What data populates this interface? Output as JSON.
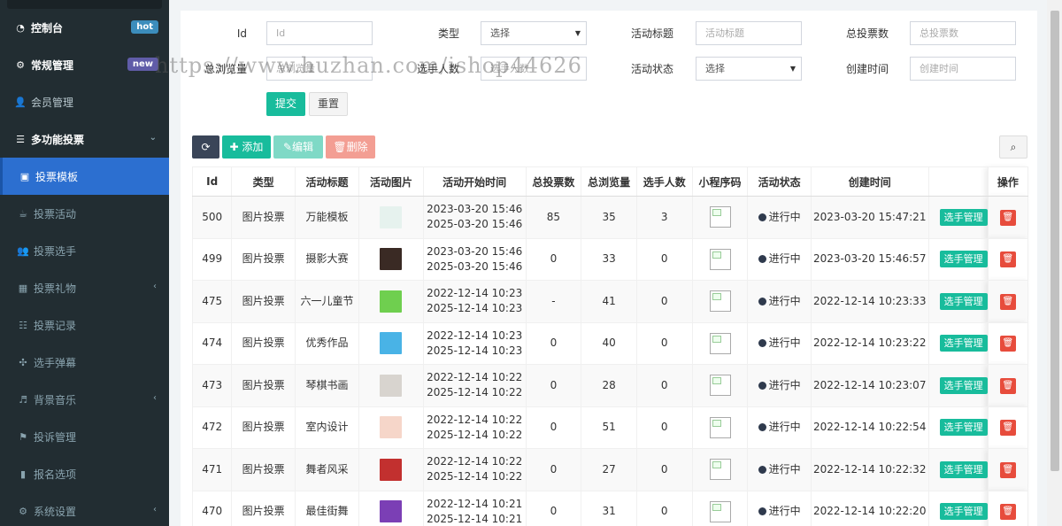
{
  "sidebar": {
    "items": [
      {
        "label": "控制台",
        "icon": "dashboard-icon",
        "badge": "hot"
      },
      {
        "label": "常规管理",
        "icon": "cogs-icon",
        "badge": "new"
      },
      {
        "label": "会员管理",
        "icon": "user-icon"
      },
      {
        "label": "多功能投票",
        "icon": "list-icon"
      },
      {
        "label": "投票模板",
        "icon": "template-icon"
      },
      {
        "label": "投票活动",
        "icon": "activity-icon"
      },
      {
        "label": "投票选手",
        "icon": "users-icon"
      },
      {
        "label": "投票礼物",
        "icon": "gift-icon"
      },
      {
        "label": "投票记录",
        "icon": "record-icon"
      },
      {
        "label": "选手弹幕",
        "icon": "barrage-icon"
      },
      {
        "label": "背景音乐",
        "icon": "music-icon"
      },
      {
        "label": "投诉管理",
        "icon": "flag-icon"
      },
      {
        "label": "报名选项",
        "icon": "signup-icon"
      },
      {
        "label": "系统设置",
        "icon": "settings-icon"
      }
    ]
  },
  "search_form": {
    "id_label": "Id",
    "id_placeholder": "Id",
    "type_label": "类型",
    "type_value": "选择",
    "title_label": "活动标题",
    "title_placeholder": "活动标题",
    "votes_label": "总投票数",
    "votes_placeholder": "总投票数",
    "views_label": "总浏览量",
    "views_placeholder": "总浏览量",
    "players_label": "选手人数",
    "players_placeholder": "选手人数",
    "status_label": "活动状态",
    "status_value": "选择",
    "created_label": "创建时间",
    "created_placeholder": "创建时间",
    "submit_label": "提交",
    "reset_label": "重置"
  },
  "toolbar": {
    "add_label": "添加",
    "edit_label": "编辑",
    "delete_label": "删除"
  },
  "table": {
    "columns": [
      "Id",
      "类型",
      "活动标题",
      "活动图片",
      "活动开始时间",
      "总投票数",
      "总浏览量",
      "选手人数",
      "小程序码",
      "活动状态",
      "创建时间",
      "",
      "操作"
    ],
    "manage_label": "选手管理",
    "rows": [
      {
        "id": "500",
        "type": "图片投票",
        "title": "万能模板",
        "start": "2023-03-20 15:46",
        "end": "2025-03-20 15:46",
        "votes": "85",
        "views": "35",
        "players": "3",
        "status": "进行中",
        "created": "2023-03-20 15:47:21",
        "thumb_color": "#e6f2ee"
      },
      {
        "id": "499",
        "type": "图片投票",
        "title": "摄影大赛",
        "start": "2023-03-20 15:46",
        "end": "2025-03-20 15:46",
        "votes": "0",
        "views": "33",
        "players": "0",
        "status": "进行中",
        "created": "2023-03-20 15:46:57",
        "thumb_color": "#3a2a24"
      },
      {
        "id": "475",
        "type": "图片投票",
        "title": "六一儿童节",
        "start": "2022-12-14 10:23",
        "end": "2025-12-14 10:23",
        "votes": "-",
        "views": "41",
        "players": "0",
        "status": "进行中",
        "created": "2022-12-14 10:23:33",
        "thumb_color": "#6fcf4f"
      },
      {
        "id": "474",
        "type": "图片投票",
        "title": "优秀作品",
        "start": "2022-12-14 10:23",
        "end": "2025-12-14 10:23",
        "votes": "0",
        "views": "40",
        "players": "0",
        "status": "进行中",
        "created": "2022-12-14 10:23:22",
        "thumb_color": "#49b3e6"
      },
      {
        "id": "473",
        "type": "图片投票",
        "title": "琴棋书画",
        "start": "2022-12-14 10:22",
        "end": "2025-12-14 10:22",
        "votes": "0",
        "views": "28",
        "players": "0",
        "status": "进行中",
        "created": "2022-12-14 10:23:07",
        "thumb_color": "#d8d4cf"
      },
      {
        "id": "472",
        "type": "图片投票",
        "title": "室内设计",
        "start": "2022-12-14 10:22",
        "end": "2025-12-14 10:22",
        "votes": "0",
        "views": "51",
        "players": "0",
        "status": "进行中",
        "created": "2022-12-14 10:22:54",
        "thumb_color": "#f6d6c9"
      },
      {
        "id": "471",
        "type": "图片投票",
        "title": "舞者风采",
        "start": "2022-12-14 10:22",
        "end": "2025-12-14 10:22",
        "votes": "0",
        "views": "27",
        "players": "0",
        "status": "进行中",
        "created": "2022-12-14 10:22:32",
        "thumb_color": "#c2302f"
      },
      {
        "id": "470",
        "type": "图片投票",
        "title": "最佳街舞",
        "start": "2022-12-14 10:21",
        "end": "2025-12-14 10:21",
        "votes": "0",
        "views": "31",
        "players": "0",
        "status": "进行中",
        "created": "2022-12-14 10:22:20",
        "thumb_color": "#7b3fb5"
      }
    ]
  },
  "watermark": "https://www.huzhan.com/ishop44626"
}
